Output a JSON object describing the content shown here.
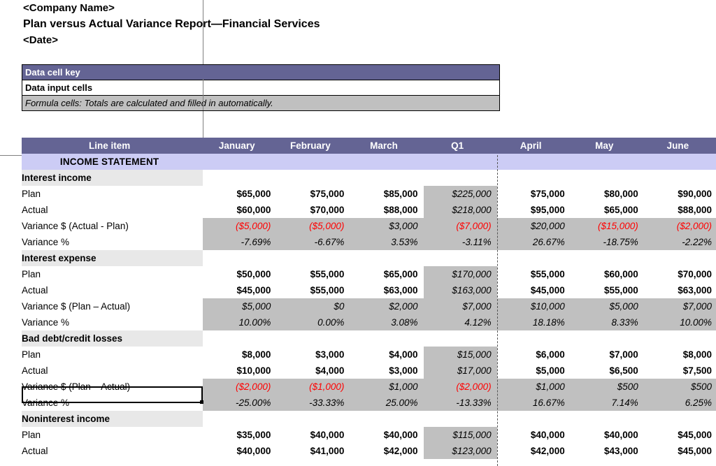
{
  "title": {
    "company": "<Company Name>",
    "report": "Plan versus Actual Variance Report—Financial Services",
    "date": "<Date>"
  },
  "colors": {
    "header_purple": "#646494",
    "banner_lavender": "#ccccf5",
    "formula_gray": "#c0c0c0",
    "group_gray": "#e8e8e8",
    "negative_red": "#ff0000"
  },
  "data_cell_key": {
    "header": "Data cell key",
    "input_row": "Data input cells",
    "formula_row": "Formula cells: Totals are calculated and filled in automatically."
  },
  "table": {
    "columns": [
      "Line item",
      "January",
      "February",
      "March",
      "Q1",
      "April",
      "May",
      "June"
    ],
    "banner": "INCOME STATEMENT",
    "sections": [
      {
        "name": "Interest income",
        "rows": [
          {
            "label": "Plan",
            "kind": "input",
            "values": [
              "$65,000",
              "$75,000",
              "$85,000",
              "$225,000",
              "$75,000",
              "$80,000",
              "$90,000"
            ]
          },
          {
            "label": "Actual",
            "kind": "input",
            "values": [
              "$60,000",
              "$70,000",
              "$88,000",
              "$218,000",
              "$95,000",
              "$65,000",
              "$88,000"
            ]
          },
          {
            "label": "Variance $ (Actual - Plan)",
            "kind": "formula",
            "values": [
              "($5,000)",
              "($5,000)",
              "$3,000",
              "($7,000)",
              "$20,000",
              "($15,000)",
              "($2,000)"
            ],
            "negative": [
              true,
              true,
              false,
              true,
              false,
              true,
              true
            ]
          },
          {
            "label": "Variance %",
            "kind": "formula",
            "values": [
              "-7.69%",
              "-6.67%",
              "3.53%",
              "-3.11%",
              "26.67%",
              "-18.75%",
              "-2.22%"
            ],
            "negative": [
              false,
              false,
              false,
              false,
              false,
              false,
              false
            ]
          }
        ]
      },
      {
        "name": "Interest expense",
        "rows": [
          {
            "label": "Plan",
            "kind": "input",
            "values": [
              "$50,000",
              "$55,000",
              "$65,000",
              "$170,000",
              "$55,000",
              "$60,000",
              "$70,000"
            ]
          },
          {
            "label": "Actual",
            "kind": "input",
            "values": [
              "$45,000",
              "$55,000",
              "$63,000",
              "$163,000",
              "$45,000",
              "$55,000",
              "$63,000"
            ]
          },
          {
            "label": "Variance $ (Plan – Actual)",
            "kind": "formula",
            "values": [
              "$5,000",
              "$0",
              "$2,000",
              "$7,000",
              "$10,000",
              "$5,000",
              "$7,000"
            ],
            "negative": [
              false,
              false,
              false,
              false,
              false,
              false,
              false
            ]
          },
          {
            "label": "Variance %",
            "kind": "formula",
            "values": [
              "10.00%",
              "0.00%",
              "3.08%",
              "4.12%",
              "18.18%",
              "8.33%",
              "10.00%"
            ],
            "negative": [
              false,
              false,
              false,
              false,
              false,
              false,
              false
            ]
          }
        ]
      },
      {
        "name": "Bad debt/credit losses",
        "rows": [
          {
            "label": "Plan",
            "kind": "input",
            "values": [
              "$8,000",
              "$3,000",
              "$4,000",
              "$15,000",
              "$6,000",
              "$7,000",
              "$8,000"
            ]
          },
          {
            "label": "Actual",
            "kind": "input",
            "values": [
              "$10,000",
              "$4,000",
              "$3,000",
              "$17,000",
              "$5,000",
              "$6,500",
              "$7,500"
            ]
          },
          {
            "label": "Variance $ (Plan – Actual)",
            "kind": "formula",
            "selected": true,
            "values": [
              "($2,000)",
              "($1,000)",
              "$1,000",
              "($2,000)",
              "$1,000",
              "$500",
              "$500"
            ],
            "negative": [
              true,
              true,
              false,
              true,
              false,
              false,
              false
            ]
          },
          {
            "label": "Variance %",
            "kind": "formula",
            "values": [
              "-25.00%",
              "-33.33%",
              "25.00%",
              "-13.33%",
              "16.67%",
              "7.14%",
              "6.25%"
            ],
            "negative": [
              false,
              false,
              false,
              false,
              false,
              false,
              false
            ]
          }
        ]
      },
      {
        "name": "Noninterest income",
        "rows": [
          {
            "label": "Plan",
            "kind": "input",
            "values": [
              "$35,000",
              "$40,000",
              "$40,000",
              "$115,000",
              "$40,000",
              "$40,000",
              "$45,000"
            ]
          },
          {
            "label": "Actual",
            "kind": "input",
            "values": [
              "$40,000",
              "$41,000",
              "$42,000",
              "$123,000",
              "$42,000",
              "$43,000",
              "$45,000"
            ]
          }
        ]
      }
    ]
  }
}
